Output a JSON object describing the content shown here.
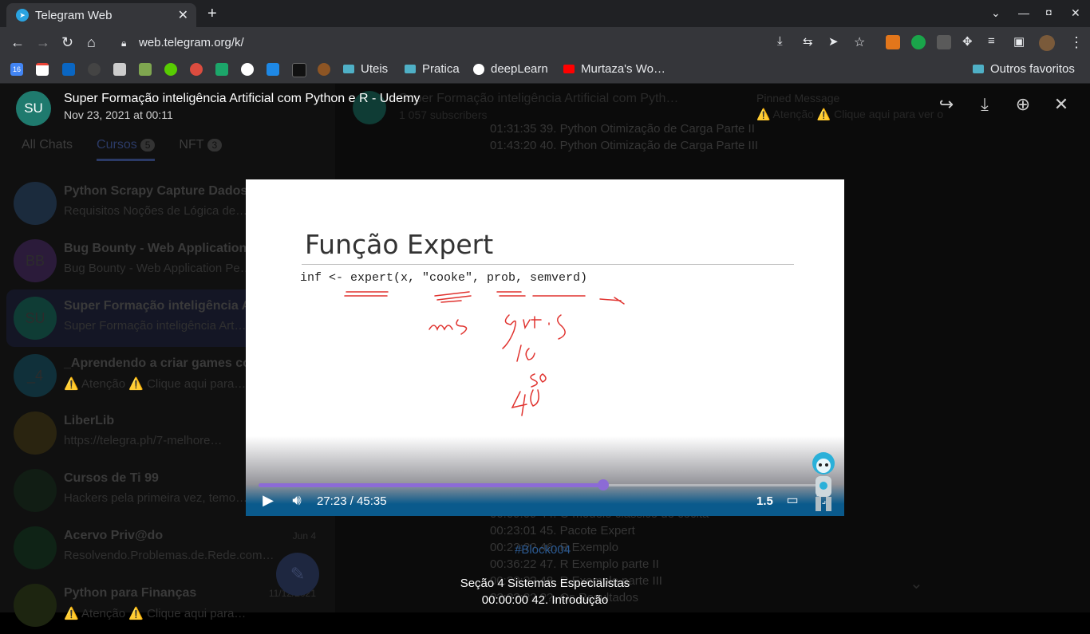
{
  "browser": {
    "tab_title": "Telegram Web",
    "url": "web.telegram.org/k/",
    "bookmarks": [
      "Uteis",
      "Pratica",
      "deepLearn",
      "Murtaza's Wo…"
    ],
    "other_bookmarks": "Outros favoritos",
    "calendar_badge": "16"
  },
  "sidebar": {
    "folders": [
      {
        "label": "All Chats",
        "count": ""
      },
      {
        "label": "Cursos",
        "count": "5"
      },
      {
        "label": "NFT",
        "count": "3"
      }
    ],
    "chats": [
      {
        "title": "Python Scrapy Capture Dados W…",
        "subtitle": "Requisitos Noções de Lógica de…",
        "initials": "",
        "date": ""
      },
      {
        "title": "Bug Bounty - Web Application Pe…",
        "subtitle": "Bug Bounty - Web Application Pe…",
        "initials": "BB",
        "date": ""
      },
      {
        "title": "Super Formação inteligência Art…",
        "subtitle": "Super Formação inteligência Art…",
        "initials": "SU",
        "date": ""
      },
      {
        "title": "_Aprendendo a criar games com…",
        "subtitle": "⚠️ Atenção ⚠️ Clique aqui para…",
        "initials": "_4",
        "date": ""
      },
      {
        "title": "LiberLib",
        "subtitle": "https://telegra.ph/7-melhore…",
        "initials": "",
        "date": ""
      },
      {
        "title": "Cursos de Ti 99",
        "subtitle": "Hackers pela primeira vez, temo…",
        "initials": "",
        "date": ""
      },
      {
        "title": "Acervo Priv@do",
        "subtitle": "Resolvendo.Problemas.de.Rede.com…",
        "initials": "",
        "date": "Jun 4"
      },
      {
        "title": "Python para Finanças",
        "subtitle": "⚠️ Atenção ⚠️ Clique aqui para…",
        "initials": "",
        "date": "11/12/2021"
      }
    ]
  },
  "channel": {
    "title": "Super Formação inteligência Artificial com Pyth…",
    "subscribers": "1 057 subscribers",
    "pinned_title": "Pinned Message",
    "pinned_text": "⚠️ Atenção ⚠️ Clique aqui para ver o",
    "messages_top": [
      "01:31:35 39. Python Otimização de Carga Parte II",
      "01:43:20 40. Python Otimização de Carga Parte III"
    ],
    "messages_bottom": [
      "00:09:09 44. O modelo clássico de cocita",
      "00:23:01 45. Pacote Expert",
      "00:2?:?? 46. R Exemplo",
      "00:36:22 47. R Exemplo parte II",
      "00:??:?? 48. R Exemplo parte III",
      "??:??:?? ??. Os Resultados"
    ]
  },
  "viewer": {
    "avatar": "SU",
    "title": "Super Formação inteligência Artificial com Python e R - Udemy",
    "date": "Nov 23, 2021 at 00:11",
    "slide_title": "Função Expert",
    "slide_code": "inf <- expert(x, \"cooke\", prob, semverd)",
    "time": "27:23 / 45:35",
    "speed": "1.5",
    "progress_fraction": 0.602,
    "accent": "#8c6bd6",
    "hashtag": "#Block004",
    "caption_line1": "Seção 4 Sistemas Especialistas",
    "caption_line2": "00:00:00 42. Introdução"
  }
}
